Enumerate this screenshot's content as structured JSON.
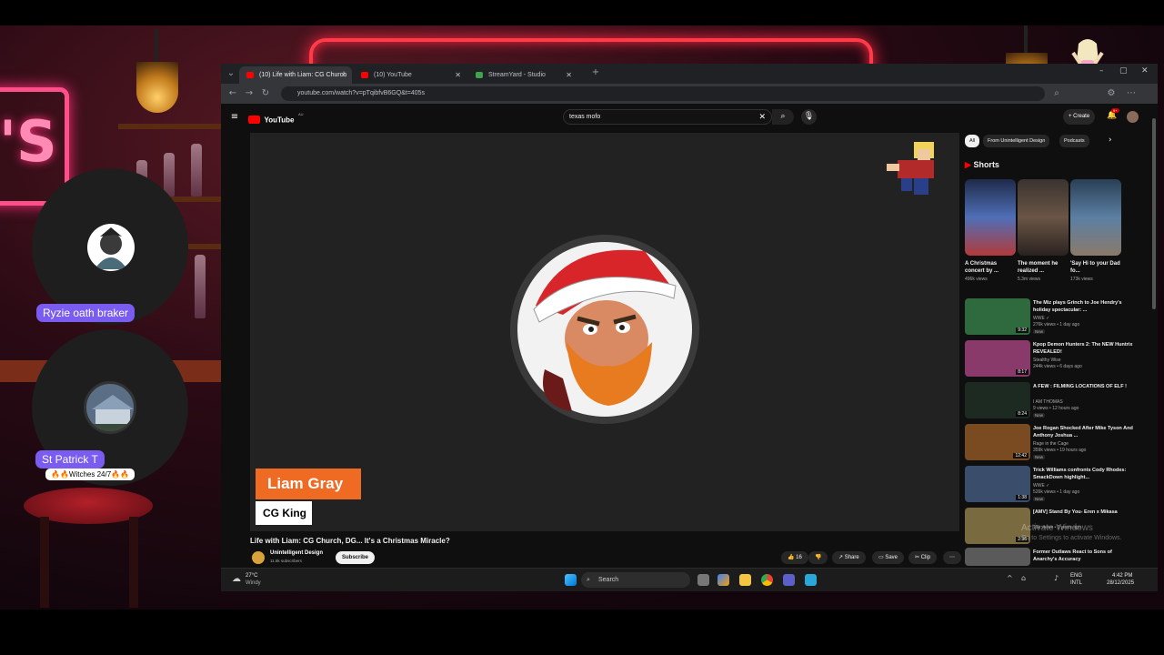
{
  "scene": {
    "guests": [
      {
        "name": "Ryzie oath braker"
      },
      {
        "name": "St Patrick T",
        "tag": "🔥🔥Witches 24/7🔥🔥"
      }
    ]
  },
  "browser": {
    "tabs": [
      {
        "label": "(10) Life with Liam: CG Church",
        "active": true,
        "favicon": "youtube-icon",
        "color": "#ff0000"
      },
      {
        "label": "(10) YouTube",
        "active": false,
        "favicon": "youtube-icon",
        "color": "#ff0000"
      },
      {
        "label": "StreamYard - Studio",
        "active": false,
        "favicon": "streamyard-icon",
        "color": "#3fa34d"
      }
    ],
    "new_tab": "+",
    "url": "youtube.com/watch?v=pTqibfvB6GQ&t=405s"
  },
  "youtube": {
    "logo": "YouTube",
    "country": "AU",
    "search_value": "texas mofo",
    "create_label": "+ Create",
    "notif_count": "9+",
    "video": {
      "lower_third_name": "Liam Gray",
      "lower_third_sub": "CG King",
      "title": "Life with Liam: CG Church, DG... It's a Christmas Miracle?",
      "channel": "Unintelligent Design",
      "subscribers": "11.6k subscribers",
      "subscribe_label": "Subscribe",
      "likes": "16",
      "share_label": "Share",
      "save_label": "Save",
      "clip_label": "Clip"
    },
    "chips": [
      {
        "label": "All",
        "selected": true
      },
      {
        "label": "From Unintelligent Design",
        "selected": false
      },
      {
        "label": "Podcasts",
        "selected": false
      }
    ],
    "shorts_title": "Shorts",
    "shorts": [
      {
        "title": "A Christmas concert by ...",
        "views": "496k views",
        "color": "#4f6fb7"
      },
      {
        "title": "The moment he realized ...",
        "views": "5.3m views",
        "color": "#6a5546"
      },
      {
        "title": "'Say Hi to your Dad fo...",
        "views": "173k views",
        "color": "#5b7fa3"
      }
    ],
    "recommended": [
      {
        "title": "The Miz plays Grinch to Joe Hendry's holiday spectacular: ...",
        "channel": "WWE ✓",
        "meta": "276k views • 1 day ago",
        "badge": "New",
        "duration": "9:32",
        "color": "#2f6a3f"
      },
      {
        "title": "Kpop Demon Hunters 2: The NEW Huntrix REVEALED!",
        "channel": "Stealthy Wise",
        "meta": "244k views • 6 days ago",
        "badge": "",
        "duration": "8:17",
        "color": "#8a3a6a"
      },
      {
        "title": "A FEW : FILMING LOCATIONS OF ELF !",
        "channel": "I AM THOMAS",
        "meta": "9 views • 12 hours ago",
        "badge": "New",
        "duration": "8:24",
        "color": "#1d2a22"
      },
      {
        "title": "Joe Rogan Shocked After Mike Tyson And Anthony Joshua ...",
        "channel": "Rage in the Cage",
        "meta": "359k views • 19 hours ago",
        "badge": "New",
        "duration": "12:42",
        "color": "#7a4a20"
      },
      {
        "title": "Trick Williams confronts Cody Rhodes: SmackDown highlight...",
        "channel": "WWE ✓",
        "meta": "526k views • 1 day ago",
        "badge": "New",
        "duration": "1:38",
        "color": "#3a4d6a"
      },
      {
        "title": "[AMV] Stand By You- Eren x Mikasa",
        "channel": "",
        "meta": "10k views • 3 years ago",
        "badge": "",
        "duration": "2:36",
        "color": "#7a6a40"
      },
      {
        "title": "Former Outlaws React to Sons of Anarchy's Accuracy",
        "channel": "",
        "meta": "",
        "badge": "",
        "duration": "",
        "color": "#5a5a5a"
      }
    ]
  },
  "taskbar": {
    "weather_temp": "27°C",
    "weather_desc": "Windy",
    "search_placeholder": "Search",
    "lang_top": "ENG",
    "lang_bottom": "INTL",
    "time": "4:42 PM",
    "date": "28/12/2025",
    "watermark_line1": "Activate Windows",
    "watermark_line2": "Go to Settings to activate Windows."
  }
}
